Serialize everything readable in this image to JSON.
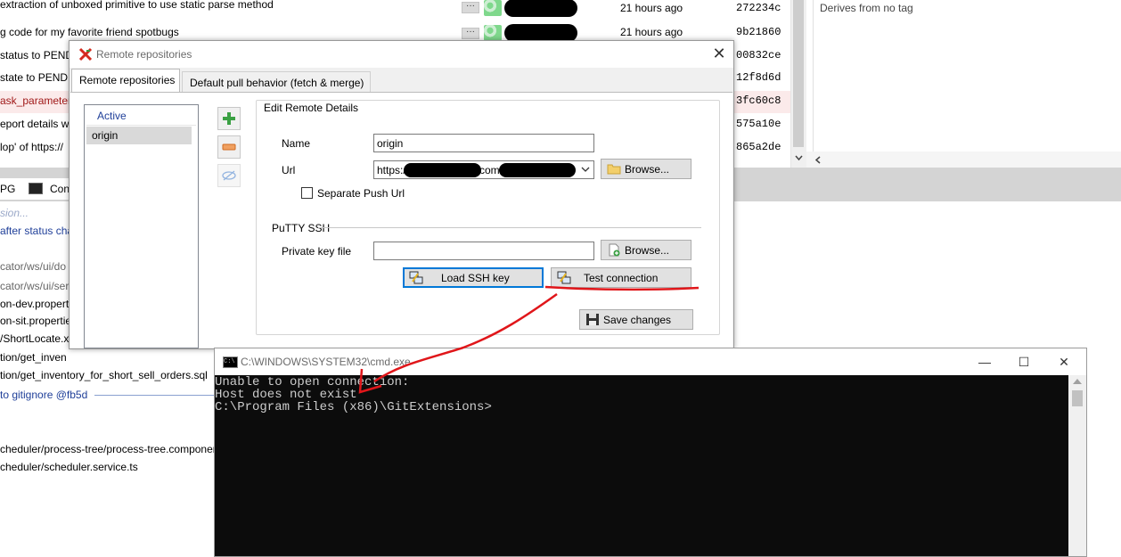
{
  "commits": [
    {
      "message": "extraction of unboxed primitive to use static parse method",
      "date": "21 hours ago",
      "sha": "272234c",
      "selected": false
    },
    {
      "message": "g code for my favorite friend spotbugs",
      "date": "21 hours ago",
      "sha": "9b21860",
      "selected": false
    },
    {
      "message": "status to PEND",
      "date": "",
      "sha": "00832ce",
      "selected": false
    },
    {
      "message": "state to PEND",
      "date": "",
      "sha": "12f8d6d",
      "selected": false
    },
    {
      "message": "ask_parameters",
      "date": "",
      "sha": "3fc60c8",
      "selected": true
    },
    {
      "message": "eport details w",
      "date": "",
      "sha": "575a10e",
      "selected": false
    },
    {
      "message": "lop' of https://",
      "date": "",
      "sha": "865a2de",
      "selected": false
    }
  ],
  "more_label": "···",
  "right_pane_text": "Derives from no tag",
  "bottom_tabs": {
    "gpg": "PG",
    "console": "Con"
  },
  "search_placeholder": "sion...",
  "status_line": "after status cha",
  "files": [
    "cator/ws/ui/do",
    "cator/ws/ui/ser",
    "on-dev.properti",
    "on-sit.propertie",
    "/ShortLocate.x",
    "tion/get_inven",
    "tion/get_inventory_for_short_sell_orders.sql",
    "to gitignore @fb5d",
    "cheduler/process-tree/process-tree.componer",
    "cheduler/scheduler.service.ts"
  ],
  "dialog": {
    "title": "Remote repositories",
    "tabs": [
      "Remote repositories",
      "Default pull behavior (fetch & merge)"
    ],
    "list_header": "Active",
    "remotes": [
      "origin"
    ],
    "group_title": "Edit Remote Details",
    "name_label": "Name",
    "name_value": "origin",
    "url_label": "Url",
    "url_value": "https://",
    "url_mid": "com",
    "browse_label": "Browse...",
    "separate_push_label": "Separate Push Url",
    "putty_label": "PuTTY SSH",
    "private_key_label": "Private key file",
    "private_key_value": "",
    "browse2_label": "Browse...",
    "load_ssh_label": "Load SSH key",
    "test_conn_label": "Test connection",
    "save_label": "Save changes"
  },
  "cmd": {
    "title": "C:\\WINDOWS\\SYSTEM32\\cmd.exe",
    "icon_text": "C:\\",
    "lines": [
      "Unable to open connection:",
      "Host does not exist",
      "C:\\Program Files (x86)\\GitExtensions>"
    ],
    "minimize": "—",
    "maximize": "☐",
    "close": "✕"
  },
  "colors": {
    "annotation": "#e0161a",
    "console_bg": "#0c0c0c",
    "console_text": "#cccccc",
    "selected_commit": "#a01818"
  }
}
